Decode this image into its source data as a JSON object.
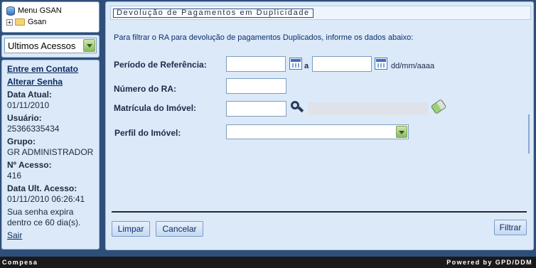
{
  "menu_tree": {
    "root_label": "Menu GSAN",
    "child_label": "Gsan"
  },
  "ultimos_acessos": {
    "selected": "Ultimos Acessos"
  },
  "user_panel": {
    "contact_link": "Entre em Contato",
    "change_password_link": "Alterar Senha",
    "current_date_label": "Data Atual:",
    "current_date_value": "01/11/2010",
    "user_label": "Usuário:",
    "user_value": "25366335434",
    "group_label": "Grupo:",
    "group_value": "GR ADMINISTRADOR",
    "access_count_label": "Nº Acesso:",
    "access_count_value": "416",
    "last_access_label": "Data Ult. Acesso:",
    "last_access_value": "01/11/2010 06:26:41",
    "password_notice": "Sua senha expira dentro ce 60 dia(s).",
    "logout_link": "Sair"
  },
  "form": {
    "title": "Devolução de Pagamentos em Duplicidade",
    "subtitle": "Para filtrar o RA para devolução de pagamentos Duplicados, informe os dados abaixo:",
    "periodo_label": "Período de Referência:",
    "periodo_inicio_value": "",
    "periodo_fim_value": "",
    "periodo_sep": "a",
    "date_format_hint": "dd/mm/aaaa",
    "numero_ra_label": "Número do RA:",
    "numero_ra_value": "",
    "matricula_label": "Matrícula do Imóvel:",
    "matricula_value": "",
    "matricula_desc_value": "",
    "perfil_label": "Perfil do Imóvel:",
    "perfil_selected": ""
  },
  "buttons": {
    "limpar": "Limpar",
    "cancelar": "Cancelar",
    "filtrar": "Filtrar"
  },
  "footer": {
    "left": "Compesa",
    "right": "Powered by GPD/DDM"
  },
  "colors": {
    "background": "#2e4f7a",
    "panel": "#dbe9f9",
    "footer": "#1a1a1a"
  }
}
